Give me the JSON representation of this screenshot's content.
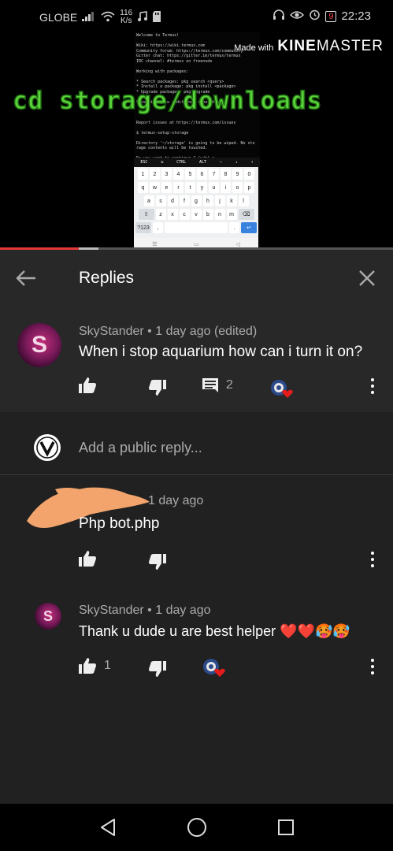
{
  "status_bar": {
    "carrier": "GLOBE",
    "net_speed_value": "116",
    "net_speed_unit": "K/s",
    "battery": "9",
    "time": "22:23"
  },
  "video": {
    "watermark_prefix": "Made with",
    "watermark_brand_bold": "KINE",
    "watermark_brand_light": "MASTER",
    "overlay_text": "cd storage/downloads",
    "terminal_lines": [
      "Welcome to Termux!",
      "",
      "Wiki:           https://wiki.termux.com",
      "Community forum: https://termux.com/community",
      "Gitter chat:    https://gitter.im/termux/termux",
      "IRC channel:    #termux on freenode",
      "",
      "Working with packages:",
      "",
      " * Search packages:   pkg search <query>",
      " * Install a package: pkg install <package>",
      " * Upgrade packages:  pkg upgrade",
      "",
      "Subscribing to additional repositories:",
      "",
      "",
      "",
      "Report issues at https://termux.com/issues",
      "",
      "$ termux-setup-storage",
      "",
      "Directory '~/storage' is going to be wiped. No sto",
      "rage contents will be touched.",
      "",
      "Do you want to continue ? (y/n) y",
      "$ cd storage"
    ],
    "terminal_keys": [
      "ESC",
      "⇆",
      "CTRL",
      "ALT",
      "—",
      "↓",
      "↑"
    ],
    "keyboard_rows": [
      [
        "1",
        "2",
        "3",
        "4",
        "5",
        "6",
        "7",
        "8",
        "9",
        "0"
      ],
      [
        "q",
        "w",
        "e",
        "r",
        "t",
        "y",
        "u",
        "i",
        "o",
        "p"
      ],
      [
        "a",
        "s",
        "d",
        "f",
        "g",
        "h",
        "j",
        "k",
        "l"
      ],
      [
        "⇧",
        "z",
        "x",
        "c",
        "v",
        "b",
        "n",
        "m",
        "⌫"
      ],
      [
        "?123",
        ",",
        "",
        ".",
        " ↵"
      ]
    ],
    "progress_fraction": 0.2,
    "buffer_fraction": 0.05
  },
  "replies_panel": {
    "title": "Replies",
    "back_icon": "arrow-left-icon",
    "close_icon": "close-icon"
  },
  "parent_comment": {
    "author": "SkyStander",
    "time": "1 day ago (edited)",
    "text": "When i stop aquarium how can i turn it on?",
    "reply_count": "2",
    "avatar_letter": "S"
  },
  "add_reply": {
    "placeholder": "Add a public reply..."
  },
  "replies": [
    {
      "author": "",
      "time": "1 day ago",
      "text": "Php bot.php",
      "likes": ""
    },
    {
      "author": "SkyStander",
      "time": "1 day ago",
      "text": "Thank u dude u are best helper ❤️❤️🥵🥵",
      "likes": "1",
      "avatar_letter": "S"
    }
  ],
  "colors": {
    "panel_bg": "#212121",
    "header_bg": "#282828",
    "overlay_green": "#5bd33a",
    "progress_red": "#e53935",
    "redact_orange": "#f2a46c"
  }
}
